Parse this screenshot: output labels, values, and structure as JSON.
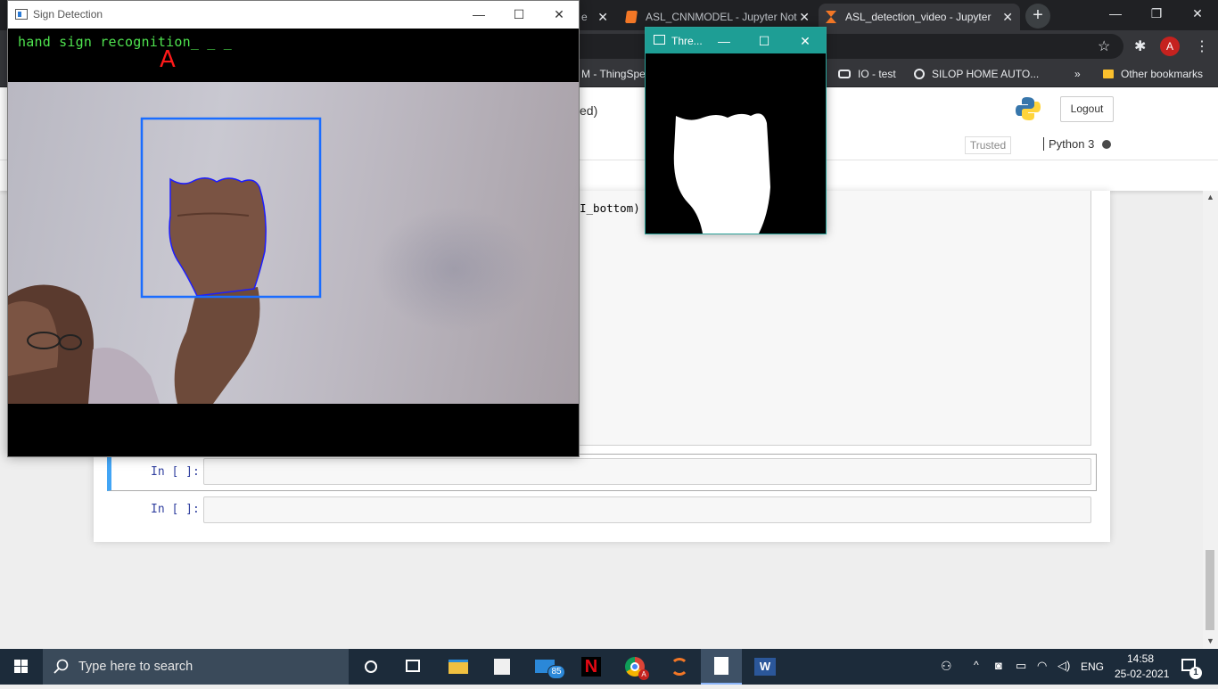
{
  "browser": {
    "tabs": [
      {
        "label": "e",
        "active": false
      },
      {
        "label": "ASL_CNNMODEL - Jupyter Not",
        "active": false
      },
      {
        "label": "ASL_detection_video - Jupyter",
        "active": true
      }
    ],
    "close_glyph": "✕",
    "new_tab_glyph": "+",
    "window_controls": {
      "minimize": "—",
      "restore": "❐",
      "close": "✕"
    },
    "toolbar": {
      "star_icon": "☆",
      "extensions_icon": "✱",
      "profile_initial": "A",
      "menu_icon": "⋮"
    },
    "bookmarks": [
      {
        "label": "M - ThingSpeak"
      },
      {
        "label": "IO - test",
        "icon": "camera-icon"
      },
      {
        "label": "SILOP HOME AUTO...",
        "icon": "globe-icon"
      },
      {
        "label": "»"
      },
      {
        "label": "Other bookmarks",
        "icon": "folder-icon"
      }
    ]
  },
  "jupyter": {
    "title_fragment": "ed)",
    "logout_label": "Logout",
    "trusted_label": "Trusted",
    "kernel_name": "Python 3",
    "code_fragment": "I_bottom)",
    "cells": [
      {
        "prompt": "In [ ]:",
        "value": ""
      },
      {
        "prompt": "In [ ]:",
        "value": ""
      }
    ],
    "scroll_up_glyph": "▲",
    "scroll_down_glyph": "▼"
  },
  "sign_window": {
    "title": "Sign Detection",
    "overlay_text": "hand sign recognition_ _ _",
    "predicted_letter": "A",
    "controls": {
      "minimize": "—",
      "maximize": "☐",
      "close": "✕"
    },
    "colors": {
      "overlay_text": "#4fe34f",
      "letter": "#ff1a1a",
      "roi_box": "#1a6dff",
      "contour": "#1c1cff"
    }
  },
  "threshold_window": {
    "title": "Thre...",
    "controls": {
      "minimize": "—",
      "maximize": "☐",
      "close": "✕"
    },
    "accent": "#1e9e95"
  },
  "taskbar": {
    "search_placeholder": "Type here to search",
    "mail_badge": "85",
    "language": "ENG",
    "time": "14:58",
    "date": "25-02-2021",
    "notification_count": "1"
  }
}
